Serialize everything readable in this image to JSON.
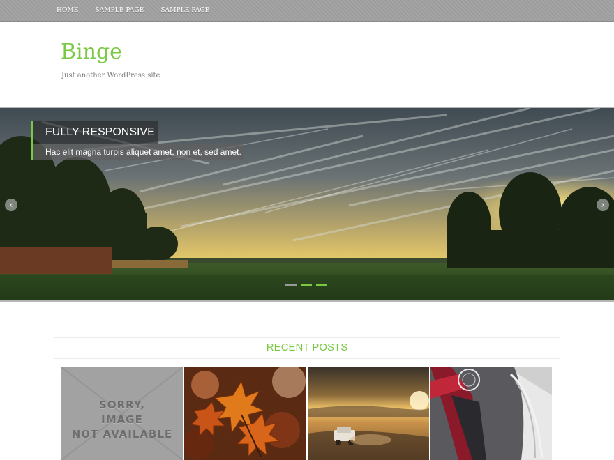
{
  "nav": {
    "items": [
      "HOME",
      "SAMPLE PAGE",
      "SAMPLE PAGE"
    ]
  },
  "site": {
    "title": "Binge",
    "description": "Just another WordPress site"
  },
  "slider": {
    "caption_title": "FULLY RESPONSIVE",
    "caption_text": "Hac elit magna turpis aliquet amet, non et, sed amet.",
    "prev_icon": "chevron-left-icon",
    "next_icon": "chevron-right-icon",
    "prev_glyph": "‹",
    "next_glyph": "›",
    "active_slide": 3,
    "dot_count": 3
  },
  "recent_posts": {
    "heading": "RECENT POSTS",
    "no_image_lines": [
      "SORRY,",
      "IMAGE",
      "NOT AVAILABLE"
    ]
  },
  "colors": {
    "accent": "#7ac943",
    "nav_bg": "#a5a5a5",
    "inactive_dot": "#9a9a9a"
  }
}
